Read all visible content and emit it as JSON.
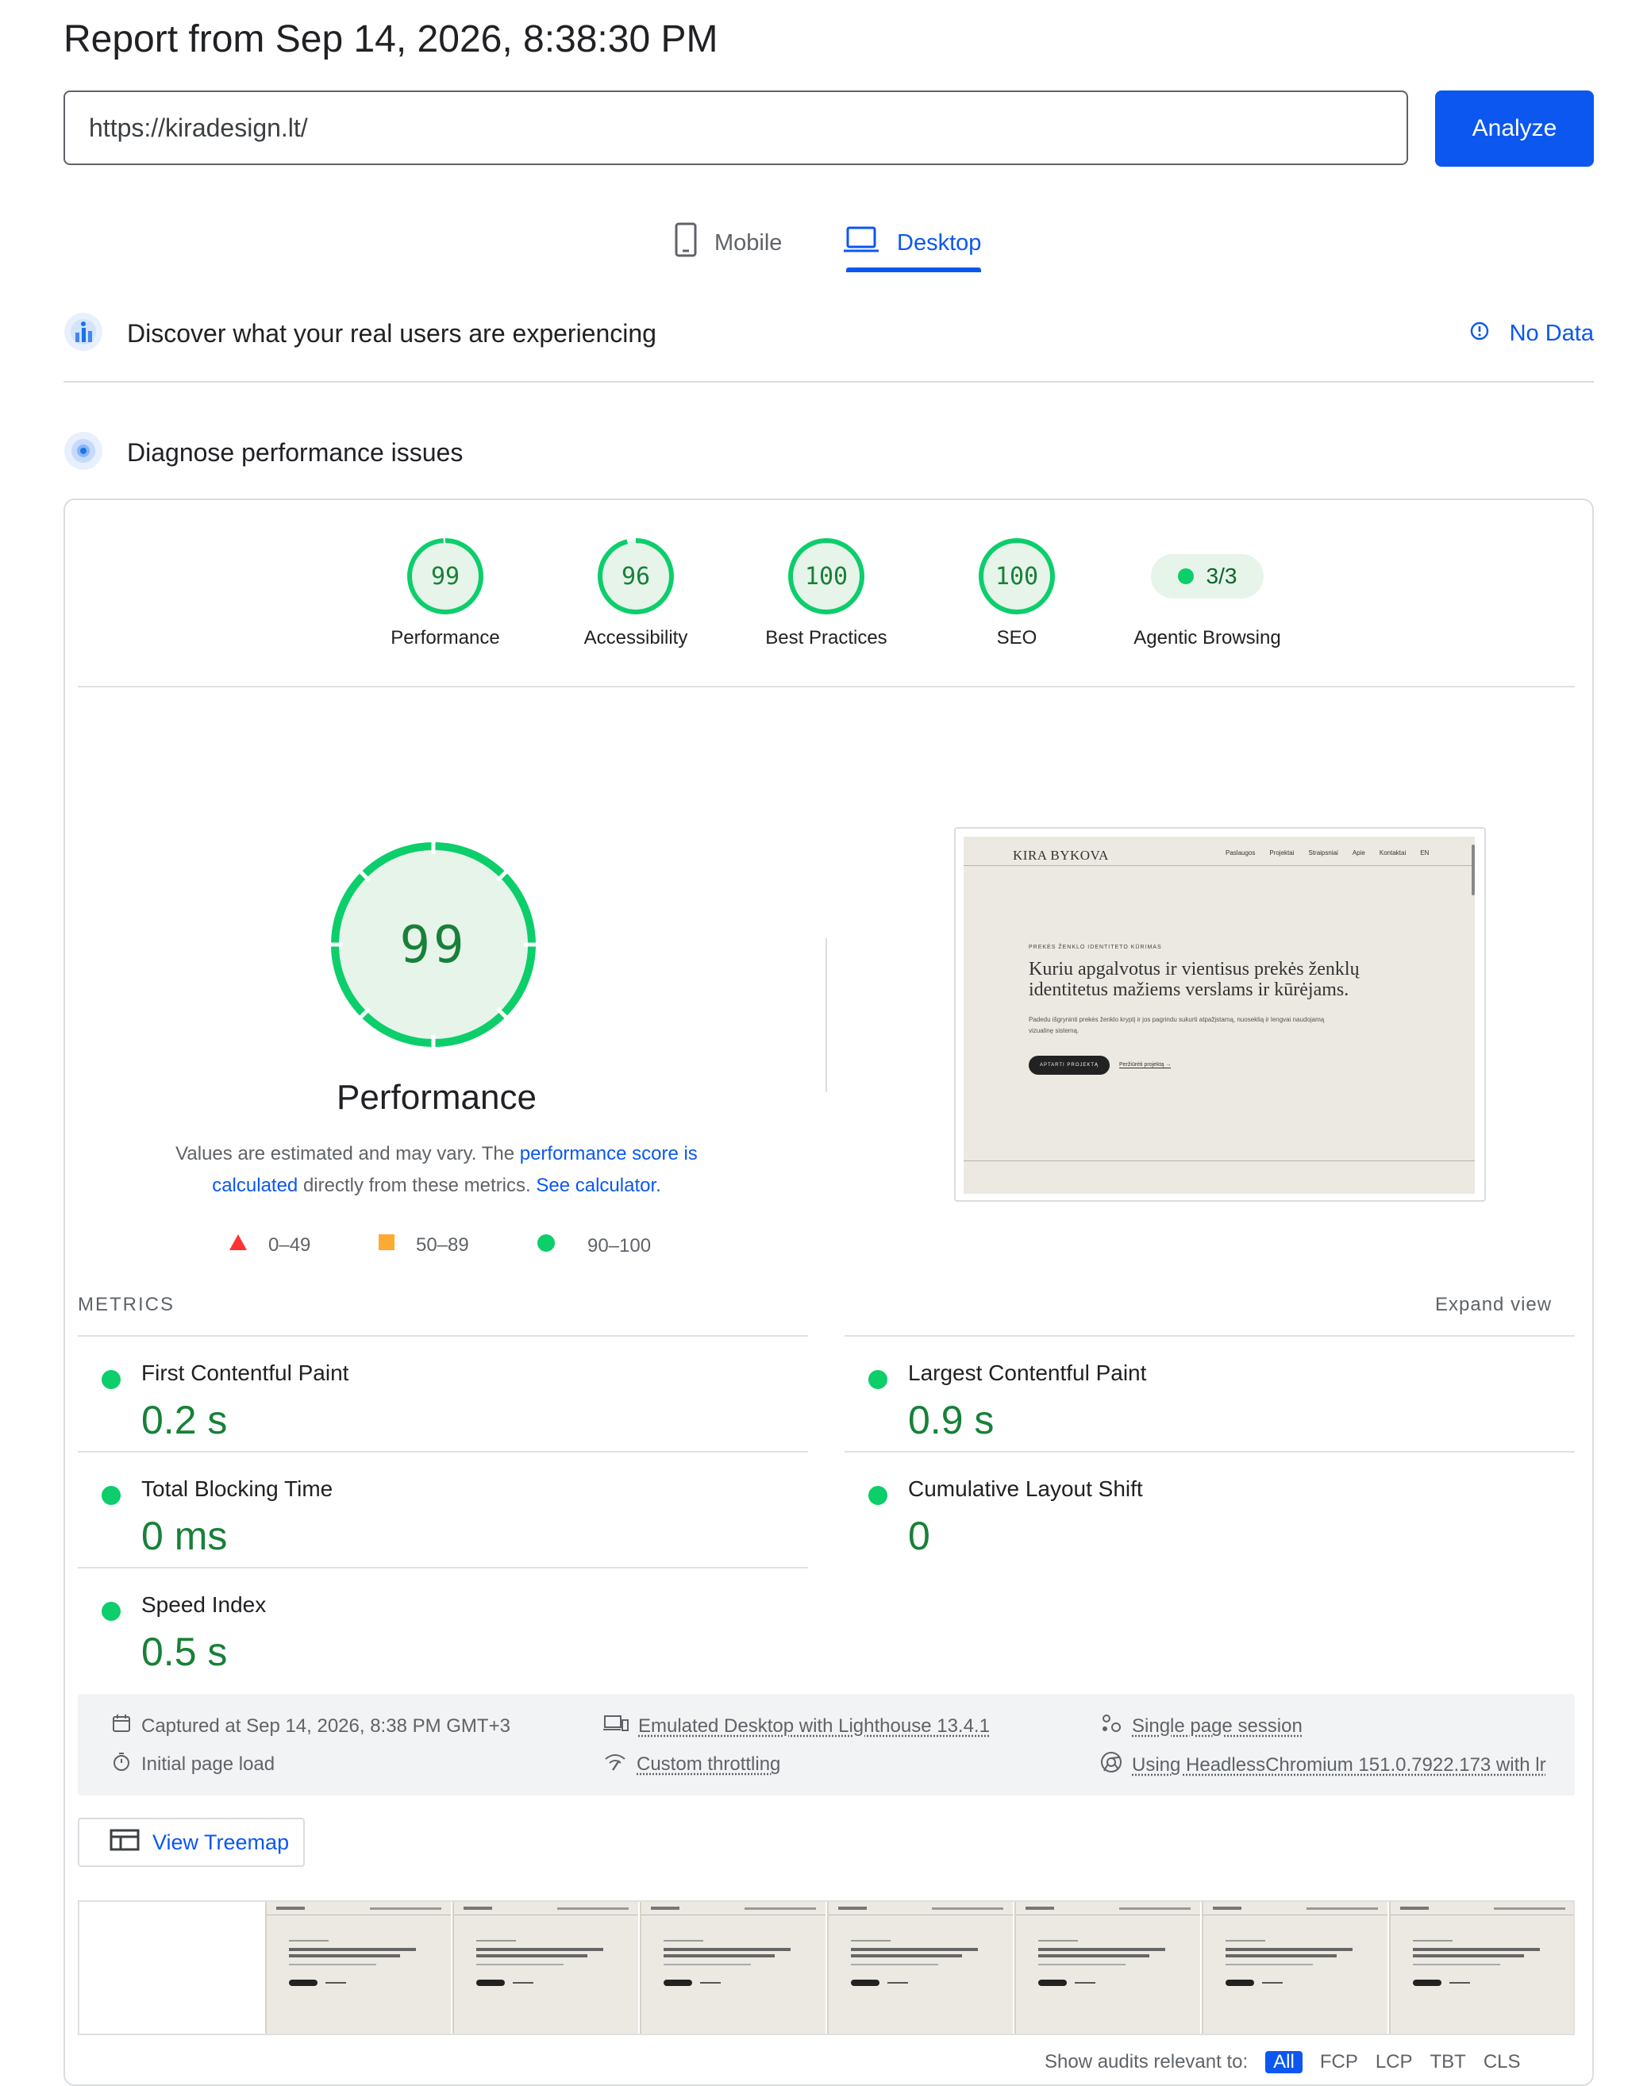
{
  "header": {
    "report_title": "Report from Sep 14, 2026, 8:38:30 PM",
    "url_value": "https://kiradesign.lt/",
    "analyze_label": "Analyze"
  },
  "tabs": [
    {
      "label": "Mobile",
      "icon": "phone-icon",
      "active": false
    },
    {
      "label": "Desktop",
      "icon": "laptop-icon",
      "active": true
    }
  ],
  "field_data": {
    "title": "Discover what your real users are experiencing",
    "status_label": "No Data",
    "icon": "users-chart-icon",
    "status_icon": "info-icon"
  },
  "lab_data": {
    "title": "Diagnose performance issues",
    "icon": "radar-icon"
  },
  "scores": [
    {
      "label": "Performance",
      "value": "99"
    },
    {
      "label": "Accessibility",
      "value": "96"
    },
    {
      "label": "Best Practices",
      "value": "100"
    },
    {
      "label": "SEO",
      "value": "100"
    },
    {
      "label": "Agentic Browsing",
      "value": "3/3"
    }
  ],
  "performance": {
    "score": "99",
    "title": "Performance",
    "desc_1": "Values are estimated and may vary. The ",
    "link_score": "performance score is calculated",
    "desc_2": " directly from these metrics. ",
    "link_calc": "See calculator."
  },
  "legend": [
    {
      "range": "0–49",
      "color": "#ff3333",
      "shape": "triangle"
    },
    {
      "range": "50–89",
      "color": "#ffaa33",
      "shape": "square"
    },
    {
      "range": "90–100",
      "color": "#0cce6b",
      "shape": "circle"
    }
  ],
  "screenshot": {
    "logo": "KIRA BYKOVA",
    "nav": [
      "Paslaugos",
      "Projektai",
      "Straipsniai",
      "Apie",
      "Kontaktai",
      "EN"
    ],
    "kicker": "PREKĖS ŽENKLO IDENTITETO KŪRIMAS",
    "headline": "Kuriu apgalvotus ir vientisus prekės ženklų identitetus mažiems verslams ir kūrėjams.",
    "sub": "Padedu išgryninti prekės ženklo kryptį ir jos pagrindu sukurti atpažįstamą, nuoseklią ir lengvai naudojamą vizualinę sistemą.",
    "cta": "APTARTI PROJEKTĄ",
    "link": "Peržiūrėti projektą →"
  },
  "metrics": {
    "heading": "METRICS",
    "expand_label": "Expand view",
    "items": [
      {
        "name": "First Contentful Paint",
        "value": "0.2 s"
      },
      {
        "name": "Largest Contentful Paint",
        "value": "0.9 s"
      },
      {
        "name": "Total Blocking Time",
        "value": "0 ms"
      },
      {
        "name": "Cumulative Layout Shift",
        "value": "0"
      },
      {
        "name": "Speed Index",
        "value": "0.5 s"
      }
    ]
  },
  "info": {
    "captured": "Captured at Sep 14, 2026, 8:38 PM GMT+3",
    "initial_load": "Initial page load",
    "emulated": "Emulated Desktop with Lighthouse 13.4.1",
    "throttling": "Custom throttling",
    "session": "Single page session",
    "browser": "Using HeadlessChromium 151.0.7922.173 with lr"
  },
  "treemap_label": "View Treemap",
  "audits_filter": {
    "label": "Show audits relevant to:",
    "chips": [
      "All",
      "FCP",
      "LCP",
      "TBT",
      "CLS"
    ]
  },
  "colors": {
    "accent": "#0b57f0",
    "pass": "#0cce6b",
    "pass_text": "#188038"
  }
}
